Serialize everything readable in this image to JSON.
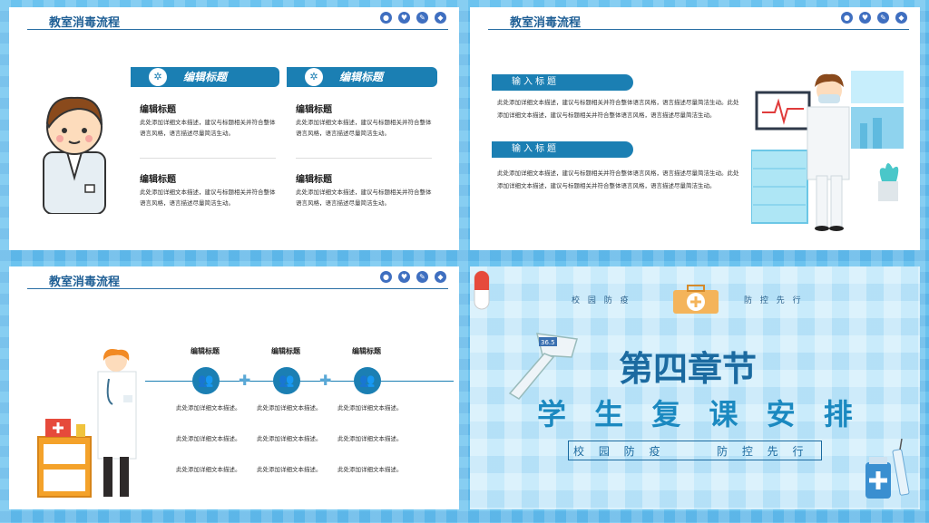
{
  "common": {
    "slide_title": "教室消毒流程",
    "icons": [
      "lock-icon",
      "heart-icon",
      "pencil-icon",
      "diamond-icon"
    ]
  },
  "slide1": {
    "banners": [
      "编辑标题",
      "编辑标题"
    ],
    "items": [
      {
        "heading": "编辑标题",
        "text": "此处添加详细文本描述，建议与标题相关并符合整体语言风格，语言描述尽量简洁生动。"
      },
      {
        "heading": "编辑标题",
        "text": "此处添加详细文本描述，建议与标题相关并符合整体语言风格，语言描述尽量简洁生动。"
      },
      {
        "heading": "编辑标题",
        "text": "此处添加详细文本描述，建议与标题相关并符合整体语言风格，语言描述尽量简洁生动。"
      },
      {
        "heading": "编辑标题",
        "text": "此处添加详细文本描述，建议与标题相关并符合整体语言风格，语言描述尽量简洁生动。"
      }
    ]
  },
  "slide2": {
    "sections": [
      {
        "label": "输入标题",
        "text": "此处添加详细文本描述，建议与标题相关并符合整体语言风格，语言描述尽量简洁生动。此处添加详细文本描述，建议与标题相关并符合整体语言风格，语言描述尽量简洁生动。"
      },
      {
        "label": "输入标题",
        "text": "此处添加详细文本描述，建议与标题相关并符合整体语言风格，语言描述尽量简洁生动。此处添加详细文本描述，建议与标题相关并符合整体语言风格，语言描述尽量简洁生动。"
      }
    ]
  },
  "slide3": {
    "columns": [
      {
        "heading": "编辑标题",
        "lines": [
          "此处添加详细文本描述。",
          "此处添加详细文本描述。",
          "此处添加详细文本描述。"
        ]
      },
      {
        "heading": "编辑标题",
        "lines": [
          "此处添加详细文本描述。",
          "此处添加详细文本描述。",
          "此处添加详细文本描述。"
        ]
      },
      {
        "heading": "编辑标题",
        "lines": [
          "此处添加详细文本描述。",
          "此处添加详细文本描述。",
          "此处添加详细文本描述。"
        ]
      }
    ]
  },
  "slide4": {
    "top_left": "校 园 防 疫",
    "top_right": "防 控 先 行",
    "thermometer_reading": "36.5",
    "chapter": "第四章节",
    "subtitle": "学 生 复 课 安 排",
    "tagline_left": "校 园 防 疫",
    "tagline_right": "防 控 先 行"
  }
}
